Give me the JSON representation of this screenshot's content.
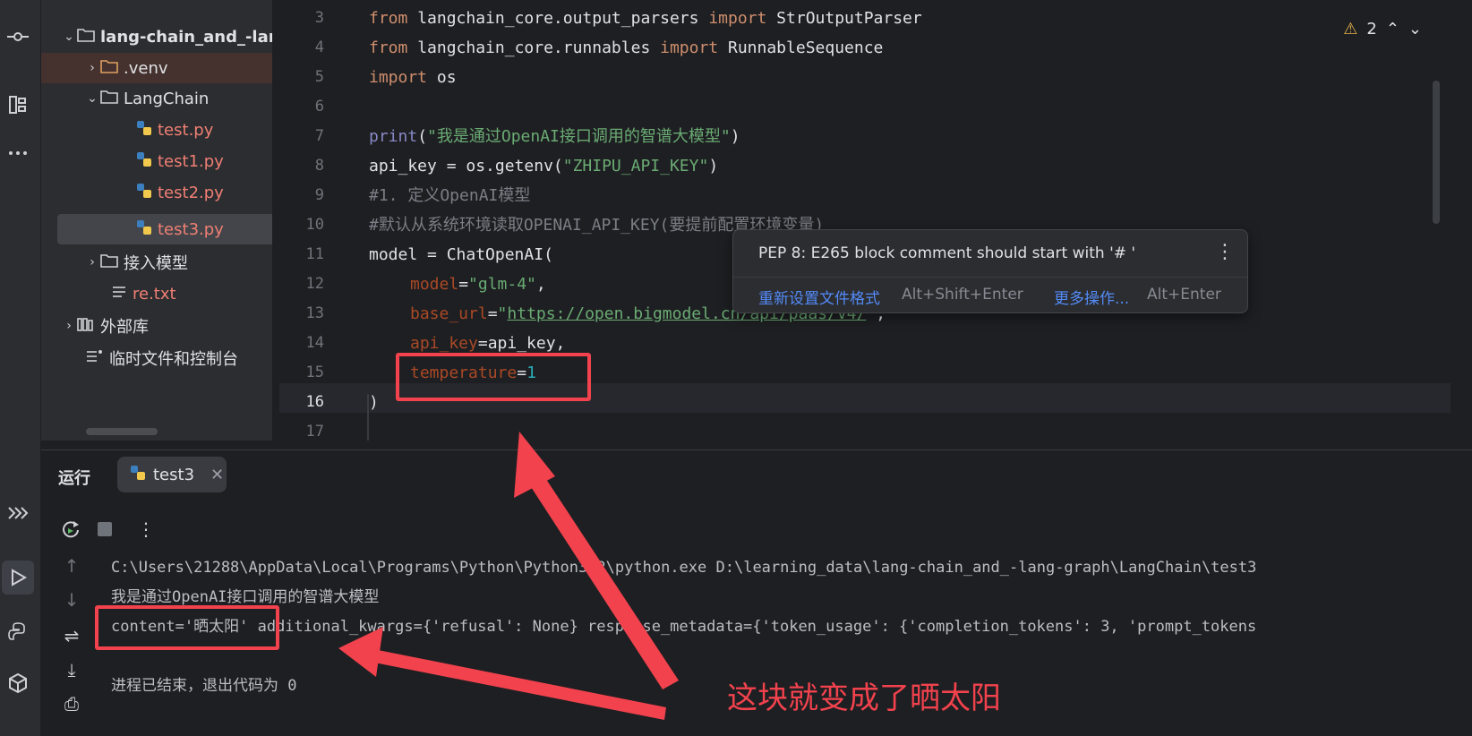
{
  "toolstrip": {
    "icons": [
      "commit-icon",
      "structure-icon",
      "more-icon",
      "services-icon",
      "run-icon",
      "python-console-icon",
      "python-packages-icon",
      "printer-icon"
    ]
  },
  "project": {
    "items": [
      {
        "label": "lang-chain_and_-lan",
        "type": "folder",
        "expanded": true
      },
      {
        "label": ".venv",
        "type": "folder",
        "expanded": false
      },
      {
        "label": "LangChain",
        "type": "folder",
        "expanded": true
      },
      {
        "label": "test.py",
        "type": "python"
      },
      {
        "label": "test1.py",
        "type": "python"
      },
      {
        "label": "test2.py",
        "type": "python"
      },
      {
        "label": "test3.py",
        "type": "python",
        "selected": true
      },
      {
        "label": "接入模型",
        "type": "folder",
        "expanded": false
      },
      {
        "label": "re.txt",
        "type": "text"
      },
      {
        "label": "外部库",
        "type": "library"
      },
      {
        "label": "临时文件和控制台",
        "type": "scratch"
      }
    ]
  },
  "editor": {
    "warnings_count": "2",
    "line_numbers": [
      "3",
      "4",
      "5",
      "6",
      "7",
      "8",
      "9",
      "10",
      "11",
      "12",
      "13",
      "14",
      "15",
      "16",
      "17"
    ],
    "lines": {
      "l3a": "from",
      "l3b": " langchain_core.output_parsers ",
      "l3c": "import",
      "l3d": " StrOutputParser",
      "l4a": "from",
      "l4b": " langchain_core.runnables ",
      "l4c": "import",
      "l4d": " RunnableSequence",
      "l5a": "import",
      "l5b": " os",
      "l7a": "print",
      "l7b": "(",
      "l7c": "\"我是通过OpenAI接口调用的智谱大模型\"",
      "l7d": ")",
      "l8a": "api_key = os.getenv(",
      "l8b": "\"ZHIPU_API_KEY\"",
      "l8c": ")",
      "l9": "#1. 定义OpenAI模型",
      "l10": "#默认从系统环境读取OPENAI_API_KEY(要提前配置环境变量)",
      "l11": "model = ChatOpenAI(",
      "l12a": "model",
      "l12b": "=",
      "l12c": "\"glm-4\"",
      "l12d": ",",
      "l13a": "base_url",
      "l13b": "=",
      "l13c": "\"",
      "l13d": "https://open.bigmodel.cn/api/paas/v4/",
      "l13e": "\"",
      "l13f": ",",
      "l14a": "api_key",
      "l14b": "=api_key,",
      "l15a": "temperature",
      "l15b": "=",
      "l15c": "1",
      "l16": ")"
    }
  },
  "popup": {
    "message": "PEP 8: E265 block comment should start with '# '",
    "action1": "重新设置文件格式",
    "action1_shortcut": "Alt+Shift+Enter",
    "action2": "更多操作...",
    "action2_shortcut": "Alt+Enter"
  },
  "run": {
    "title": "运行",
    "tab": "test3",
    "console": {
      "line1": "C:\\Users\\21288\\AppData\\Local\\Programs\\Python\\Python312\\python.exe D:\\learning_data\\lang-chain_and_-lang-graph\\LangChain\\test3",
      "line2": "我是通过OpenAI接口调用的智谱大模型",
      "line3a": "content='晒太阳'",
      "line3b": " additional_kwargs={'refusal': None} response_metadata={'token_usage': {'completion_tokens': 3, 'prompt_tokens",
      "line5": "进程已结束，退出代码为 0"
    }
  },
  "annotation": {
    "text": "这块就变成了晒太阳",
    "color": "#f2424d"
  }
}
